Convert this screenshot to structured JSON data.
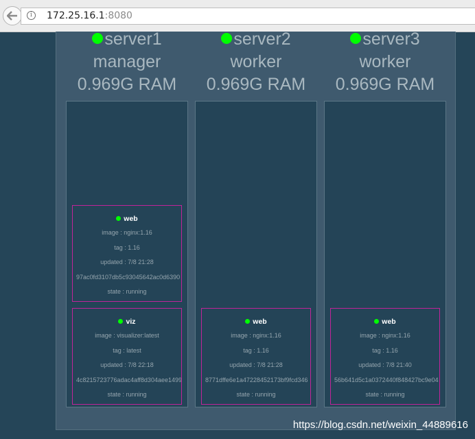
{
  "browser": {
    "back_icon": "back-arrow-icon",
    "info_icon": "i",
    "url_host": "172.25.16.1",
    "url_port": ":8080"
  },
  "nodes": [
    {
      "name": "server1",
      "role": "manager",
      "ram": "0.969G RAM",
      "status_color": "#00ff00",
      "tasks": [
        {
          "name": "web",
          "image": "image : nginx:1.16",
          "tag": "tag : 1.16",
          "updated": "updated : 7/8 21:28",
          "id": "97ac0fd3107db5c93045642ac0d6390",
          "state": "state : running"
        },
        {
          "name": "viz",
          "image": "image : visualizer:latest",
          "tag": "tag : latest",
          "updated": "updated : 7/8 22:18",
          "id": "4c8215723776adac4aff8d304aee1499",
          "state": "state : running"
        }
      ]
    },
    {
      "name": "server2",
      "role": "worker",
      "ram": "0.969G RAM",
      "status_color": "#00ff00",
      "tasks": [
        {
          "name": "web",
          "image": "image : nginx:1.16",
          "tag": "tag : 1.16",
          "updated": "updated : 7/8 21:28",
          "id": "8771dffe6e1a47228452173bf9fcd346",
          "state": "state : running"
        }
      ]
    },
    {
      "name": "server3",
      "role": "worker",
      "ram": "0.969G RAM",
      "status_color": "#00ff00",
      "tasks": [
        {
          "name": "web",
          "image": "image : nginx:1.16",
          "tag": "tag : 1.16",
          "updated": "updated : 7/8 21:40",
          "id": "56b641d5c1a0372440f848427bc9e04",
          "state": "state : running"
        }
      ]
    }
  ],
  "watermark": "https://blog.csdn.net/weixin_44889616"
}
